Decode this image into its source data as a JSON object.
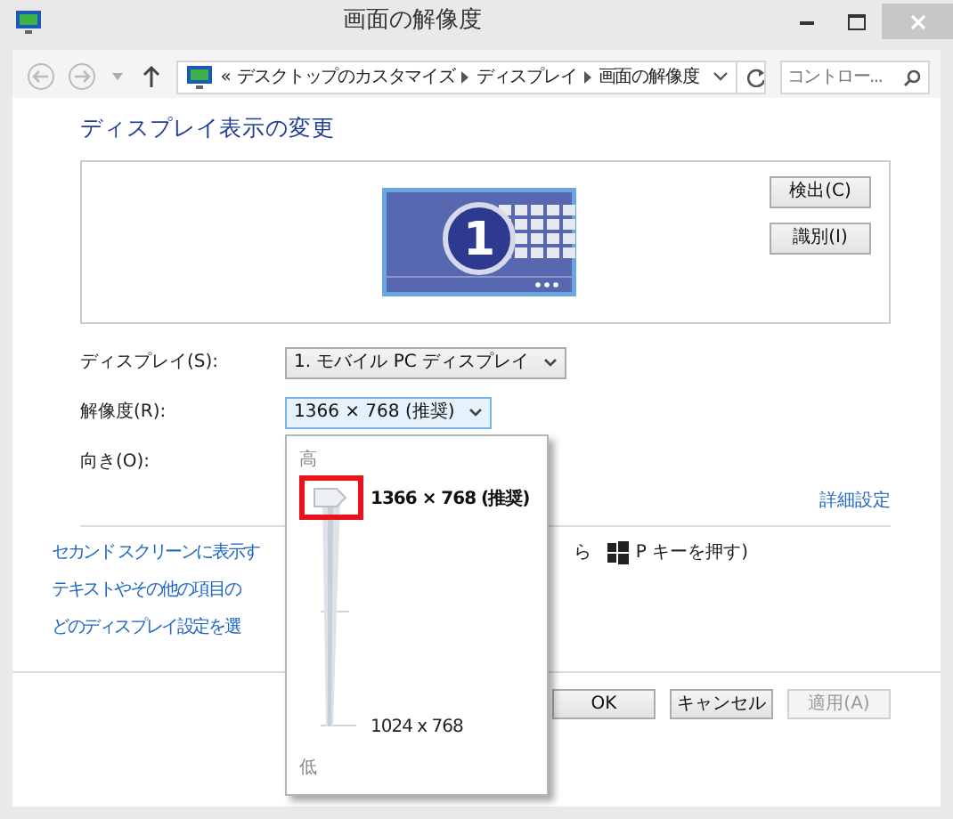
{
  "window": {
    "title": "画面の解像度"
  },
  "address_bar": {
    "prefix": "«",
    "path": [
      "デスクトップのカスタマイズ",
      "ディスプレイ",
      "画面の解像度"
    ]
  },
  "search": {
    "placeholder": "コントロー..."
  },
  "heading": "ディスプレイ表示の変更",
  "preview": {
    "display_number": "1",
    "buttons": [
      "検出(C)",
      "識別(I)"
    ]
  },
  "settings": [
    {
      "label": "ディスプレイ(S):",
      "value": "1. モバイル PC ディスプレイ",
      "expanded": false
    },
    {
      "label": "解像度(R):",
      "value": "1366 × 768 (推奨)",
      "expanded": true
    },
    {
      "label": "向き(O):"
    }
  ],
  "advanced_link": "詳細設定",
  "links": [
    {
      "text": "セカンド スクリーンに表示す",
      "after": "ら",
      "key_hint": "P キーを押す)"
    },
    {
      "text": "テキストやその他の項目の"
    },
    {
      "text": "どのディスプレイ設定を選"
    }
  ],
  "buttons": [
    {
      "label": "OK",
      "disabled": false
    },
    {
      "label": "キャンセル",
      "disabled": false
    },
    {
      "label": "適用(A)",
      "disabled": true
    }
  ],
  "resolution_popup": {
    "high_label": "高",
    "low_label": "低",
    "level": 1,
    "highlighted": true,
    "options": [
      {
        "label": "1366 × 768 (推奨)",
        "selected": true
      },
      {
        "label": "1024 x 768",
        "selected": false
      }
    ]
  }
}
